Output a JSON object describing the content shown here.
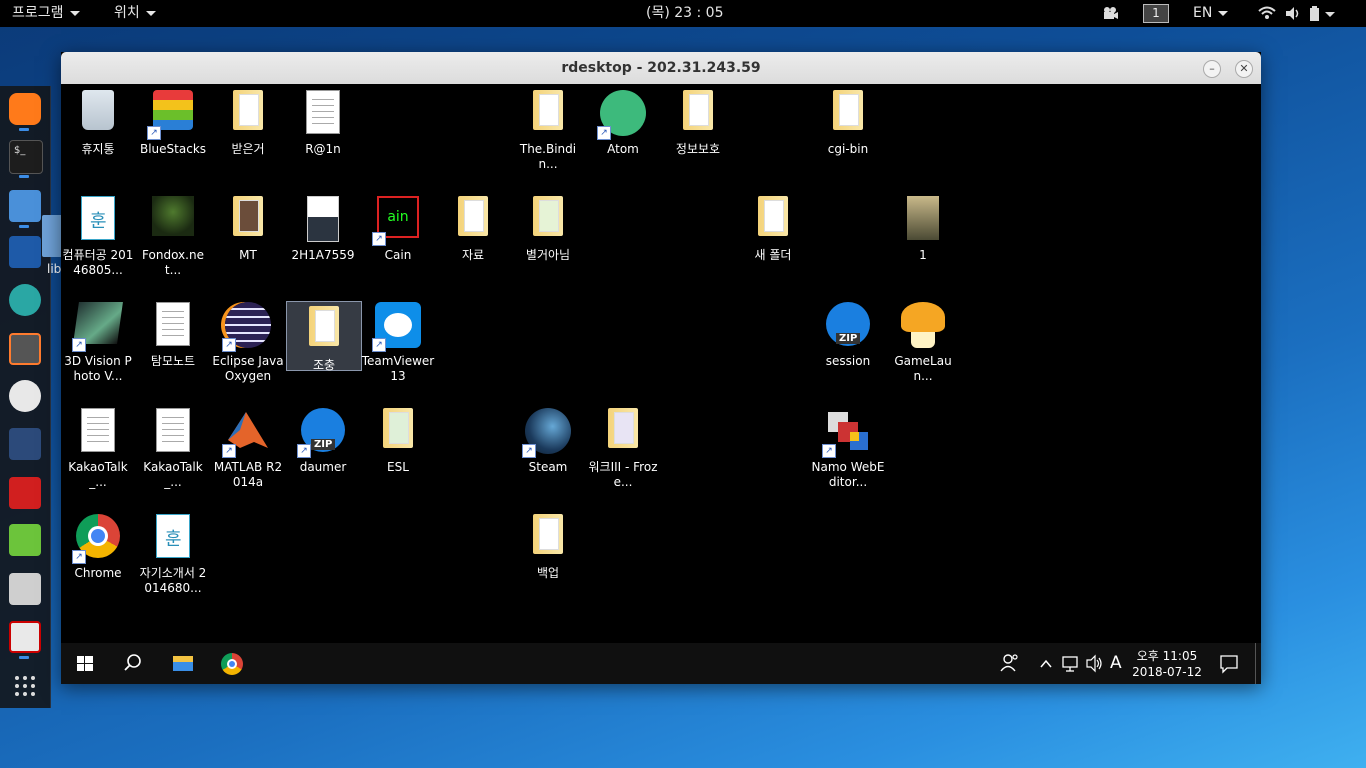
{
  "topbar": {
    "apps_menu": "프로그램",
    "places_menu": "위치",
    "clock": "(목) 23 : 05",
    "workspace": "1",
    "keyboard": "EN"
  },
  "dock": {
    "items": [
      "firefox-icon",
      "terminal-icon",
      "files-icon",
      "metasploit-icon",
      "character-app-icon",
      "burpsuite-icon",
      "maltego-icon",
      "beef-icon",
      "faraday-icon",
      "leafpad-icon",
      "keepnote-icon",
      "screenshot-icon",
      "show-apps-icon"
    ],
    "side_label": "lib"
  },
  "window": {
    "title": "rdesktop - 202.31.243.59"
  },
  "desktop_icons": [
    {
      "label": "휴지통"
    },
    {
      "label": "BlueStacks"
    },
    {
      "label": "받은거"
    },
    {
      "label": "R@1n"
    },
    {
      "label": "The.Bindin..."
    },
    {
      "label": "Atom"
    },
    {
      "label": "정보보호"
    },
    {
      "label": "cgi-bin"
    },
    {
      "label": "컴퓨터공 20146805..."
    },
    {
      "label": "Fondox.net..."
    },
    {
      "label": "MT"
    },
    {
      "label": "2H1A7559"
    },
    {
      "label": "Cain"
    },
    {
      "label": "자료"
    },
    {
      "label": "별거아님"
    },
    {
      "label": "새 폴더"
    },
    {
      "label": "1"
    },
    {
      "label": "3D Vision Photo V..."
    },
    {
      "label": "탐모노트"
    },
    {
      "label": "Eclipse Java Oxygen"
    },
    {
      "label": "조충"
    },
    {
      "label": "TeamViewer 13"
    },
    {
      "label": "session"
    },
    {
      "label": "GameLaun..."
    },
    {
      "label": "KakaoTalk_..."
    },
    {
      "label": "KakaoTalk_..."
    },
    {
      "label": "MATLAB R2014a"
    },
    {
      "label": "daumer"
    },
    {
      "label": "ESL"
    },
    {
      "label": "Steam"
    },
    {
      "label": "워크III - Froze..."
    },
    {
      "label": "Namo WebEditor..."
    },
    {
      "label": "Chrome"
    },
    {
      "label": "자기소개서 2014680..."
    },
    {
      "label": "백업"
    }
  ],
  "taskbar": {
    "ime": "A",
    "time": "오후 11:05",
    "date": "2018-07-12"
  },
  "colors": {
    "accent": "#3c8de6",
    "taskbar_bg": "#101010"
  }
}
